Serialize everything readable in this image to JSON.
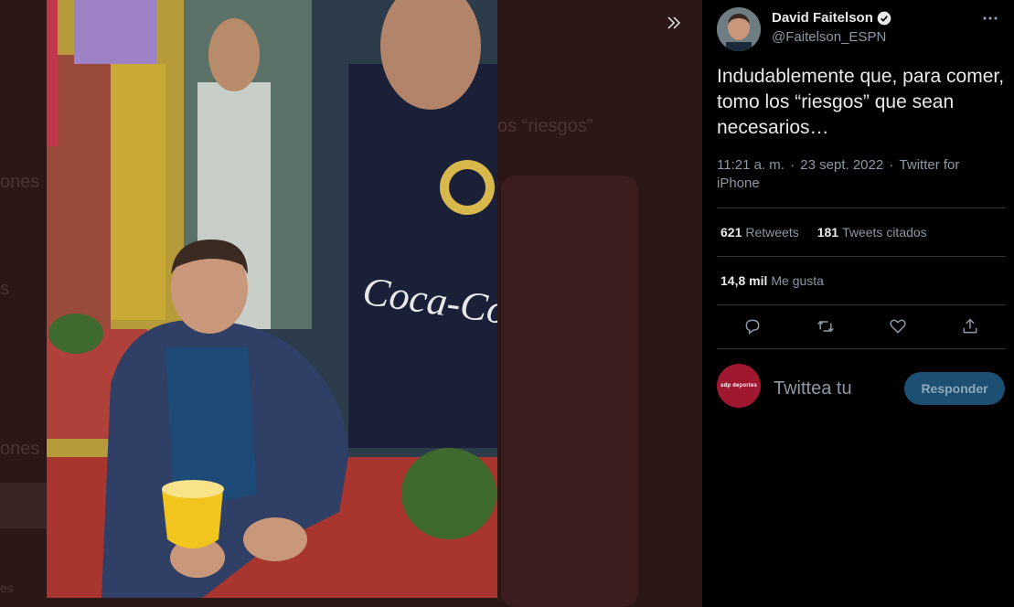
{
  "backdrop": {
    "ghost_texts": [
      "ones",
      "s",
      "ones",
      "es",
      "os “riesgos”"
    ]
  },
  "media": {
    "expand_icon": "chevrons-right-icon"
  },
  "tweet": {
    "author_name": "David Faitelson",
    "author_handle": "@Faitelson_ESPN",
    "verified_icon": "verified-badge-icon",
    "more_icon": "more-horizontal-icon",
    "text": "Indudablemente que, para comer, tomo los “riesgos” que sean necesarios…",
    "time": "11:21 a. m.",
    "date": "23 sept. 2022",
    "source": "Twitter for iPhone",
    "retweets_count": "621",
    "retweets_label": "Retweets",
    "quotes_count": "181",
    "quotes_label": "Tweets citados",
    "likes_count": "14,8 mil",
    "likes_label": "Me gusta"
  },
  "actions": {
    "reply_icon": "reply-icon",
    "retweet_icon": "retweet-icon",
    "like_icon": "heart-icon",
    "share_icon": "share-icon"
  },
  "reply": {
    "avatar_text": "sdp deportes",
    "placeholder": "Twittea tu",
    "button_label": "Responder"
  },
  "colors": {
    "panel_bg": "#000000",
    "reply_button_bg": "#1d4f73",
    "muted_text": "#8b98a5"
  }
}
